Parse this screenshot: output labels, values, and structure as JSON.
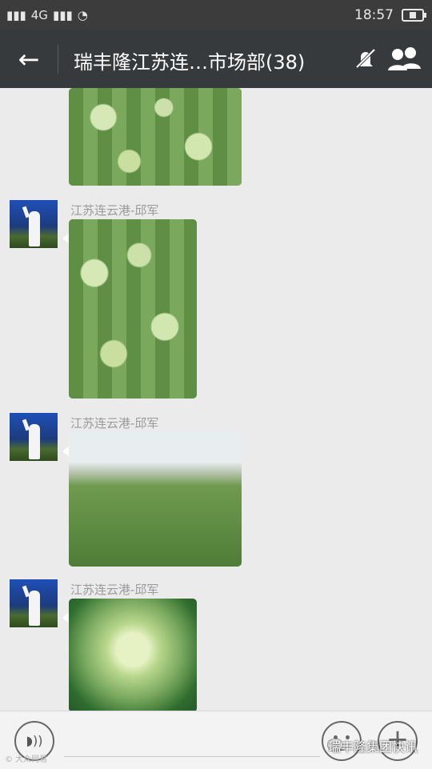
{
  "status": {
    "left_text": "4G",
    "time": "18:57"
  },
  "header": {
    "back_label": "←",
    "title": "瑞丰隆江苏连…市场部(38)"
  },
  "messages": [
    {
      "sender": "",
      "kind": "field"
    },
    {
      "sender": "江苏连云港-邱军",
      "kind": "field"
    },
    {
      "sender": "江苏连云港-邱军",
      "kind": "tunnel"
    },
    {
      "sender": "江苏连云港-邱军",
      "kind": "closeup"
    }
  ],
  "footer": {
    "voice_icon": "voice-icon",
    "emoji_icon": "emoji-icon",
    "plus_icon": "plus-icon",
    "watermark": "瑞丰隆集团快讯",
    "mini_watermark": "© 大众网易"
  }
}
